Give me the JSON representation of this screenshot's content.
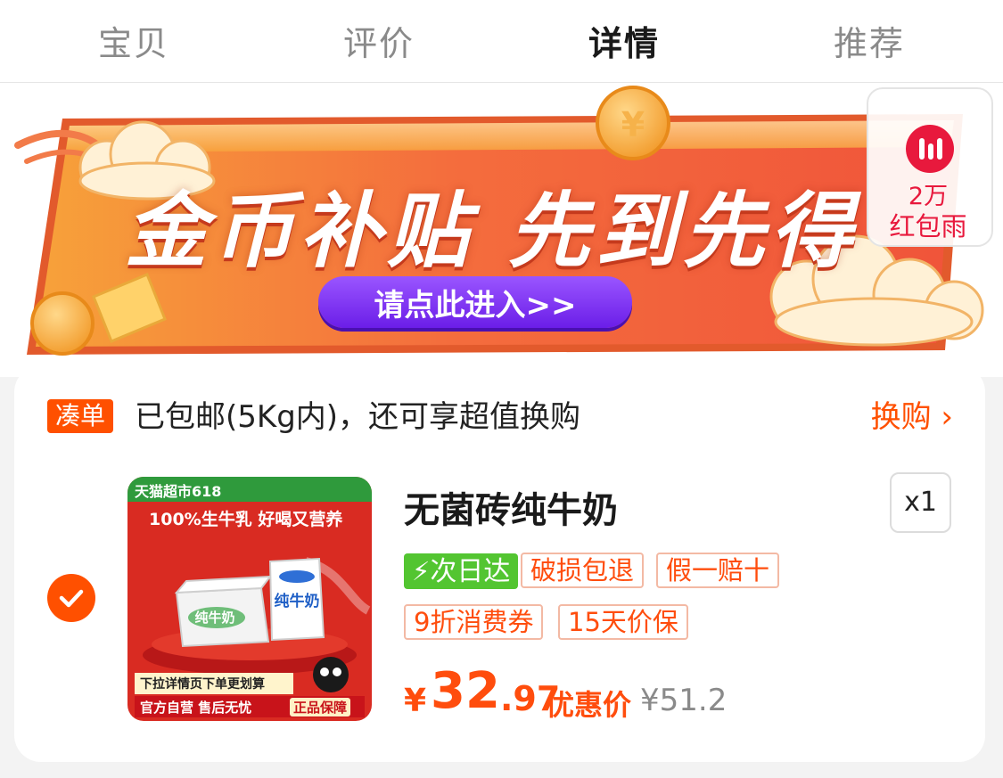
{
  "tabs": [
    {
      "label": "宝贝",
      "active": false
    },
    {
      "label": "评价",
      "active": false
    },
    {
      "label": "详情",
      "active": true
    },
    {
      "label": "推荐",
      "active": false
    }
  ],
  "banner": {
    "title": "金币补贴 先到先得",
    "enter_label": "请点此进入>>"
  },
  "red_packet_rain": {
    "count": "2万",
    "label": "红包雨",
    "icon": "bar-chart-icon"
  },
  "shipping": {
    "tag": "凑单",
    "text": "已包邮(5Kg内)，还可享超值换购",
    "swap_label": "换购 ›"
  },
  "product": {
    "selected": true,
    "name": "无菌砖纯牛奶",
    "quantity": "x1",
    "image": {
      "top_tag": "天猫超市618",
      "slogan": "100%生牛乳 好喝又营养",
      "note": "下拉详情页下单更划算",
      "strip_left": "官方自营 售后无忧",
      "strip_right": "正品保障",
      "box_label": "纯牛奶"
    },
    "tags": {
      "next_day": "次日达",
      "damage": "破损包退",
      "fake": "假一赔十",
      "coupon": "9折消费券",
      "price_protect": "15天价保"
    },
    "price": {
      "currency": "¥",
      "integer": "32",
      "decimal": ".97",
      "label": "优惠价",
      "original": "¥51.2"
    }
  },
  "colors": {
    "accent": "#ff5000",
    "next_day_green": "#53c531",
    "rain_red": "#e8193d",
    "button_purple": "#7b2cf0"
  }
}
